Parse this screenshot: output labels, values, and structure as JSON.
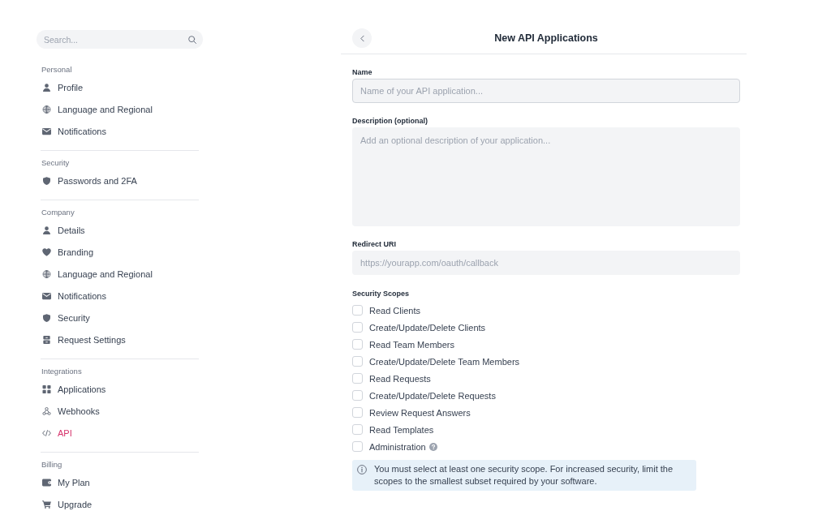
{
  "sidebar": {
    "search": {
      "placeholder": "Search..."
    },
    "sections": [
      {
        "title": "Personal",
        "items": [
          {
            "label": "Profile",
            "selected": false
          },
          {
            "label": "Language and Regional",
            "selected": false
          },
          {
            "label": "Notifications",
            "selected": false
          }
        ]
      },
      {
        "title": "Security",
        "items": [
          {
            "label": "Passwords and 2FA",
            "selected": false
          }
        ]
      },
      {
        "title": "Company",
        "items": [
          {
            "label": "Details",
            "selected": false
          },
          {
            "label": "Branding",
            "selected": false
          },
          {
            "label": "Language and Regional",
            "selected": false
          },
          {
            "label": "Notifications",
            "selected": false
          },
          {
            "label": "Security",
            "selected": false
          },
          {
            "label": "Request Settings",
            "selected": false
          }
        ]
      },
      {
        "title": "Integrations",
        "items": [
          {
            "label": "Applications",
            "selected": false
          },
          {
            "label": "Webhooks",
            "selected": false
          },
          {
            "label": "API",
            "selected": true
          }
        ]
      },
      {
        "title": "Billing",
        "items": [
          {
            "label": "My Plan",
            "selected": false
          },
          {
            "label": "Upgrade",
            "selected": false
          }
        ]
      }
    ]
  },
  "header": {
    "title": "New API Applications"
  },
  "form": {
    "fields": [
      {
        "kind": "input",
        "label": "Name",
        "placeholder": "Name of your API application...",
        "focused": true
      },
      {
        "kind": "textarea",
        "label": "Description (optional)",
        "placeholder": "Add an optional description of your application...",
        "focused": false
      },
      {
        "kind": "input",
        "label": "Redirect URI",
        "placeholder": "https://yourapp.com/oauth/callback",
        "focused": false
      }
    ],
    "scopes": {
      "title": "Security Scopes",
      "items": [
        {
          "label": "Read Clients",
          "checked": false,
          "help": false
        },
        {
          "label": "Create/Update/Delete Clients",
          "checked": false,
          "help": false
        },
        {
          "label": "Read Team Members",
          "checked": false,
          "help": false
        },
        {
          "label": "Create/Update/Delete Team Members",
          "checked": false,
          "help": false
        },
        {
          "label": "Read Requests",
          "checked": false,
          "help": false
        },
        {
          "label": "Create/Update/Delete Requests",
          "checked": false,
          "help": false
        },
        {
          "label": "Review Request Answers",
          "checked": false,
          "help": false
        },
        {
          "label": "Read Templates",
          "checked": false,
          "help": false
        },
        {
          "label": "Administration",
          "checked": false,
          "help": true
        }
      ]
    },
    "notice": {
      "text": "You must select at least one security scope. For increased security, limit the scopes to the smallest subset required by your software."
    }
  }
}
